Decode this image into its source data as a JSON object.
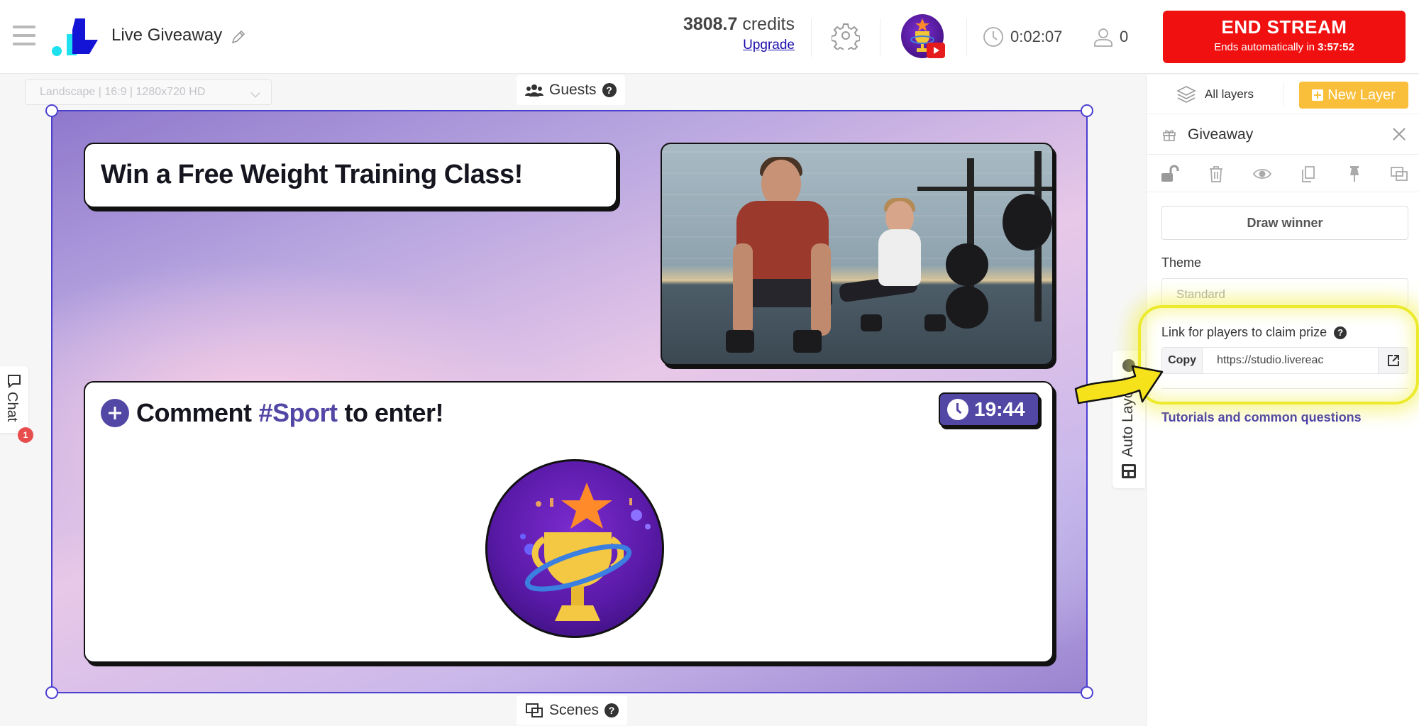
{
  "header": {
    "app_title": "Live Giveaway",
    "credits_amount": "3808.7",
    "credits_unit": "credits",
    "upgrade_label": "Upgrade",
    "elapsed_time": "0:02:07",
    "viewer_count": "0",
    "end_stream": {
      "label": "END STREAM",
      "subtitle_prefix": "Ends automatically in",
      "countdown": "3:57:52",
      "color": "#f01010"
    }
  },
  "canvas": {
    "layout_select_value": "Landscape | 16:9 | 1280x720 HD",
    "guests_label": "Guests",
    "scenes_label": "Scenes",
    "help_glyph": "?",
    "title_card_text": "Win a Free Weight Training Class!",
    "comment_prefix": "Comment",
    "comment_hashtag": "#Sport",
    "comment_suffix": "to enter!",
    "timer_value": "19:44",
    "accent_color": "#5247a5",
    "selection_color": "#4b3fd0"
  },
  "side_tabs": {
    "chat_label": "Chat",
    "chat_badge": "1",
    "autolayout_label": "Auto Layout"
  },
  "right_panel": {
    "all_layers_label": "All layers",
    "new_layer_label": "New Layer",
    "layer_name": "Giveaway",
    "tools": [
      "unlock-icon",
      "trash-icon",
      "eye-icon",
      "duplicate-icon",
      "pin-icon",
      "scenes-icon"
    ],
    "draw_winner_label": "Draw winner",
    "theme_label": "Theme",
    "theme_value": "Standard",
    "claim_link_label": "Link for players to claim prize",
    "copy_label": "Copy",
    "claim_link_value": "https://studio.livereac",
    "tutorials_label": "Tutorials and common questions",
    "new_layer_color": "#f9be3a"
  }
}
